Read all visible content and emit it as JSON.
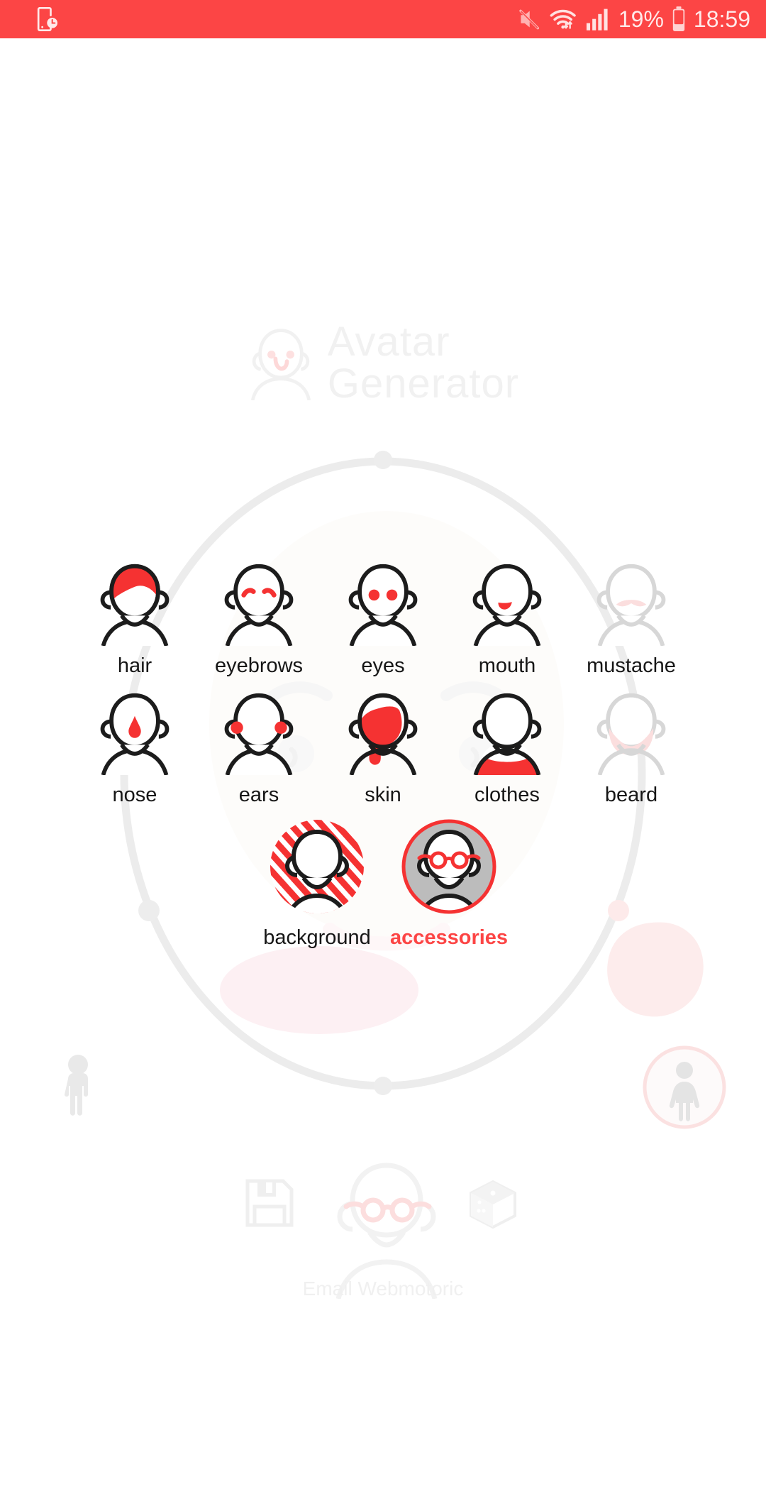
{
  "status_bar": {
    "background_color": "#fc4545",
    "foreground_color": "#ffe9e9",
    "left_icons": [
      "screen-time-icon"
    ],
    "right_icons": [
      "mute-icon",
      "wifi-icon",
      "signal-icon",
      "battery-icon"
    ],
    "battery_percent": "19%",
    "time": "18:59"
  },
  "watermark": {
    "line1": "Avatar",
    "line2": "Generator",
    "icon": "baby-face-icon"
  },
  "theme": {
    "accent": "#fc4545",
    "accent_strong": "#f53232",
    "outline": "#1c1c1c",
    "disabled": "#d5d5d5",
    "faint": "#f0f0f0",
    "gray_fill": "#bcbcbc"
  },
  "features": {
    "rows": [
      [
        {
          "id": "hair",
          "label": "hair",
          "state": "enabled",
          "icon": "avatar-hair-icon"
        },
        {
          "id": "eyebrows",
          "label": "eyebrows",
          "state": "enabled",
          "icon": "avatar-eyebrows-icon"
        },
        {
          "id": "eyes",
          "label": "eyes",
          "state": "enabled",
          "icon": "avatar-eyes-icon"
        },
        {
          "id": "mouth",
          "label": "mouth",
          "state": "enabled",
          "icon": "avatar-mouth-icon"
        },
        {
          "id": "mustache",
          "label": "mustache",
          "state": "disabled",
          "icon": "avatar-mustache-icon"
        }
      ],
      [
        {
          "id": "nose",
          "label": "nose",
          "state": "enabled",
          "icon": "avatar-nose-icon"
        },
        {
          "id": "ears",
          "label": "ears",
          "state": "enabled",
          "icon": "avatar-ears-icon"
        },
        {
          "id": "skin",
          "label": "skin",
          "state": "enabled",
          "icon": "avatar-skin-icon"
        },
        {
          "id": "clothes",
          "label": "clothes",
          "state": "enabled",
          "icon": "avatar-clothes-icon"
        },
        {
          "id": "beard",
          "label": "beard",
          "state": "disabled",
          "icon": "avatar-beard-icon"
        }
      ],
      [
        {
          "id": "background",
          "label": "background",
          "state": "enabled",
          "icon": "avatar-background-icon"
        },
        {
          "id": "accessories",
          "label": "accessories",
          "state": "selected",
          "icon": "avatar-accessories-icon"
        }
      ]
    ]
  },
  "gender": {
    "male": {
      "label": "male",
      "icon": "male-figure-icon",
      "state": "unselected"
    },
    "female": {
      "label": "female",
      "icon": "female-figure-icon",
      "state": "highlighted"
    }
  },
  "bottom": {
    "save": {
      "label": "save",
      "icon": "floppy-disk-icon"
    },
    "randomize": {
      "label": "randomize",
      "icon": "dice-icon"
    },
    "preview": {
      "icon": "avatar-preview-icon"
    },
    "email_text": "Email Webmotoric"
  }
}
